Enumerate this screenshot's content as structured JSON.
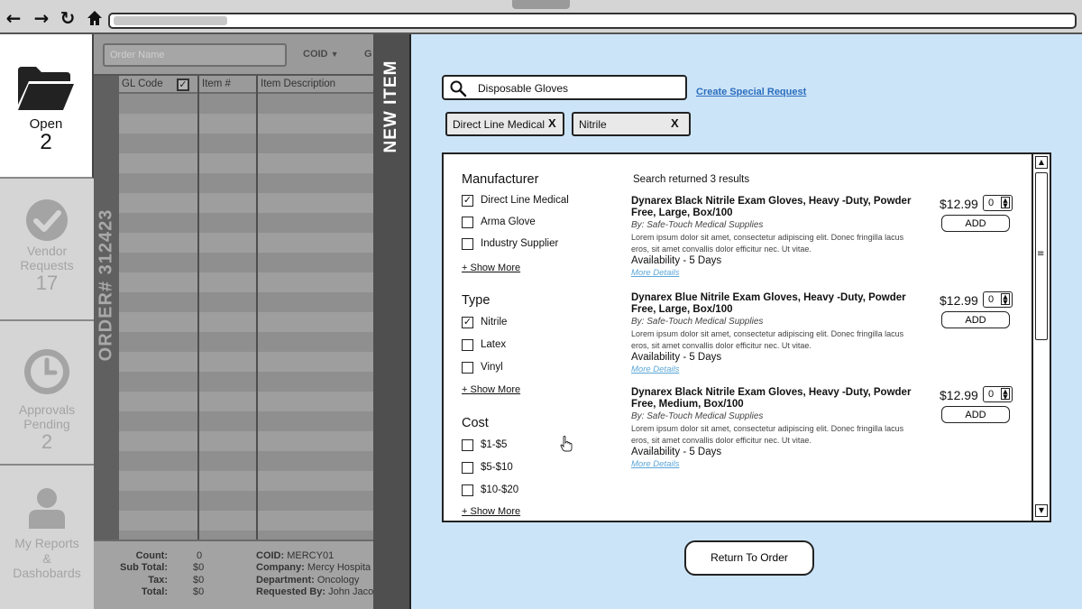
{
  "sidebar": {
    "items": [
      {
        "label": "Open",
        "count": "2",
        "icon": "folder-icon",
        "active": true
      },
      {
        "label": "Vendor\nRequests",
        "count": "17",
        "icon": "check-circle-icon"
      },
      {
        "label": "Approvals\nPending",
        "count": "2",
        "icon": "clock-icon"
      },
      {
        "label": "My Reports\n&\nDashobards",
        "icon": "user-icon"
      }
    ]
  },
  "order": {
    "name_placeholder": "Order Name",
    "coid_label": "COID",
    "next_col_letter": "G",
    "order_number": "ORDER# 312423",
    "columns": [
      "GL Code",
      "Item #",
      "Item Description"
    ],
    "summary": {
      "count_label": "Count:",
      "count": "0",
      "subtotal_label": "Sub Total:",
      "subtotal": "$0",
      "tax_label": "Tax:",
      "tax": "$0",
      "total_label": "Total:",
      "total": "$0"
    },
    "details": {
      "coid_label": "COID:",
      "coid": "MERCY01",
      "company_label": "Company:",
      "company": "Mercy Hospita",
      "department_label": "Department:",
      "department": "Oncology",
      "requested_by_label": "Requested By:",
      "requested_by": "John Jaco"
    }
  },
  "panel_title": "NEW ITEM",
  "search": {
    "value": "Disposable Gloves",
    "special_request": "Create Special Request"
  },
  "chips": [
    {
      "label": "Direct Line Medical",
      "remove": "X"
    },
    {
      "label": "Nitrile",
      "remove": "X"
    }
  ],
  "filters": {
    "manufacturer": {
      "title": "Manufacturer",
      "options": [
        {
          "label": "Direct Line Medical",
          "checked": true
        },
        {
          "label": "Arma Glove",
          "checked": false
        },
        {
          "label": "Industry Supplier",
          "checked": false
        }
      ],
      "show_more": "+ Show More"
    },
    "type": {
      "title": "Type",
      "options": [
        {
          "label": "Nitrile",
          "checked": true
        },
        {
          "label": "Latex",
          "checked": false
        },
        {
          "label": "Vinyl",
          "checked": false
        }
      ],
      "show_more": "+ Show More"
    },
    "cost": {
      "title": "Cost",
      "options": [
        {
          "label": "$1-$5",
          "checked": false
        },
        {
          "label": "$5-$10",
          "checked": false
        },
        {
          "label": "$10-$20",
          "checked": false
        }
      ],
      "show_more": "+ Show More"
    }
  },
  "results": {
    "count_text": "Search returned 3 results",
    "items": [
      {
        "name": "Dynarex Black Nitrile Exam Gloves, Heavy -Duty, Powder Free, Large, Box/100",
        "by": "By: Safe-Touch Medical Supplies",
        "desc": "Lorem ipsum dolor sit amet, consectetur adipiscing elit. Donec fringilla lacus eros, sit amet convallis dolor efficitur nec. Ut vitae.",
        "availability": "Availability - 5 Days",
        "more": "More Details",
        "price": "$12.99",
        "qty": "0",
        "add": "ADD"
      },
      {
        "name": "Dynarex Blue Nitrile Exam Gloves, Heavy -Duty, Powder Free, Large, Box/100",
        "by": "By: Safe-Touch Medical Supplies",
        "desc": "Lorem ipsum dolor sit amet, consectetur adipiscing elit. Donec fringilla lacus eros, sit amet convallis dolor efficitur nec. Ut vitae.",
        "availability": "Availability - 5 Days",
        "more": "More Details",
        "price": "$12.99",
        "qty": "0",
        "add": "ADD"
      },
      {
        "name": "Dynarex Black Nitrile Exam Gloves, Heavy -Duty, Powder Free, Medium, Box/100",
        "by": "By: Safe-Touch Medical Supplies",
        "desc": "Lorem ipsum dolor sit amet, consectetur adipiscing elit. Donec fringilla lacus eros, sit amet convallis dolor efficitur nec. Ut vitae.",
        "availability": "Availability - 5 Days",
        "more": "More Details",
        "price": "$12.99",
        "qty": "0",
        "add": "ADD"
      }
    ]
  },
  "return_label": "Return To Order",
  "colors": {
    "panel_bg": "#cce4f8",
    "link": "#2a6ebd",
    "details_link": "#5aa6d8",
    "sidebar_bg": "#d5d5d5"
  }
}
